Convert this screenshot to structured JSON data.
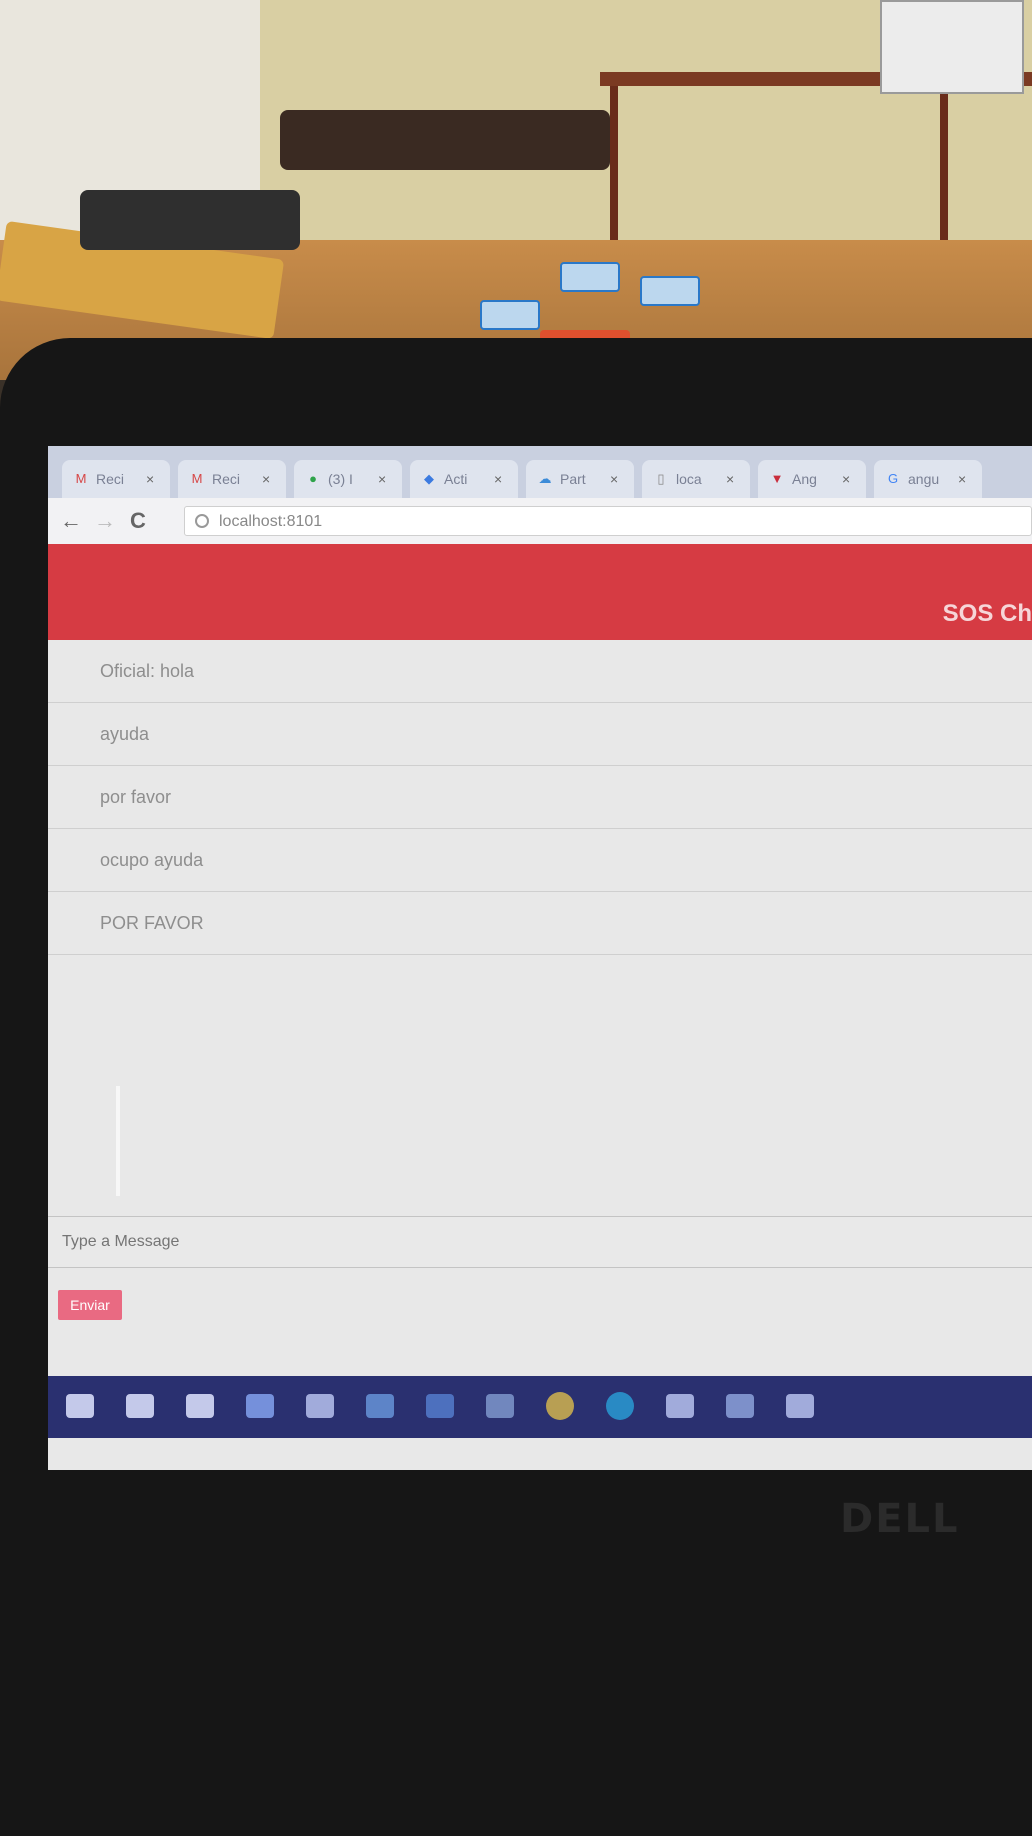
{
  "browser": {
    "tabs": [
      {
        "icon": "gmail-icon",
        "glyph": "M",
        "color": "#d64545",
        "label": "Reci"
      },
      {
        "icon": "gmail-icon",
        "glyph": "M",
        "color": "#d64545",
        "label": "Reci"
      },
      {
        "icon": "green-circle-icon",
        "glyph": "●",
        "color": "#2fa34a",
        "label": "(3) I"
      },
      {
        "icon": "pin-icon",
        "glyph": "◆",
        "color": "#3c7be0",
        "label": "Acti"
      },
      {
        "icon": "cloud-icon",
        "glyph": "☁",
        "color": "#3c8bd8",
        "label": "Part"
      },
      {
        "icon": "page-icon",
        "glyph": "▯",
        "color": "#888888",
        "label": "loca"
      },
      {
        "icon": "shield-icon",
        "glyph": "▼",
        "color": "#c92d3c",
        "label": "Ang"
      },
      {
        "icon": "google-icon",
        "glyph": "G",
        "color": "#4285f4",
        "label": "angu"
      }
    ],
    "close_glyph": "×",
    "nav": {
      "back": "←",
      "forward": "→",
      "reload": "C"
    },
    "url": "localhost:8101"
  },
  "app": {
    "title": "SOS Ch",
    "accent": "#d63b43",
    "messages": [
      "Oficial: hola",
      "ayuda",
      "por favor",
      "ocupo ayuda",
      "POR FAVOR"
    ],
    "input_placeholder": "Type a Message",
    "send_label": "Enviar",
    "send_color": "#e96a82"
  },
  "taskbar": {
    "color": "#2a3070",
    "items": [
      "start-icon",
      "search-icon",
      "task-view-icon",
      "file-explorer-icon",
      "notes-icon",
      "calendar-icon",
      "app-icon",
      "photos-icon",
      "chrome-icon",
      "skype-icon",
      "network-icon",
      "user-icon",
      "folder-icon"
    ]
  },
  "laptop": {
    "brand": "DELL"
  }
}
